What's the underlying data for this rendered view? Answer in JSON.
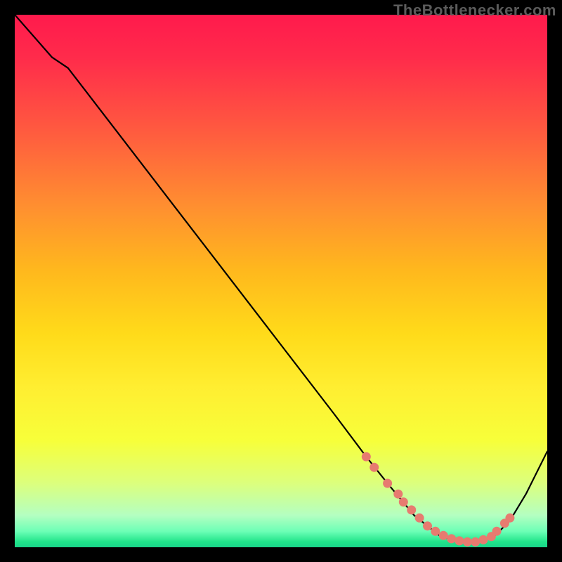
{
  "watermark": "TheBottlenecker.com",
  "chart_data": {
    "type": "line",
    "title": "",
    "xlabel": "",
    "ylabel": "",
    "xlim": [
      0,
      100
    ],
    "ylim": [
      0,
      100
    ],
    "series": [
      {
        "name": "curve",
        "x": [
          0,
          7,
          10,
          20,
          30,
          40,
          50,
          60,
          66,
          70,
          75,
          80,
          84,
          87,
          90,
          93,
          96,
          100
        ],
        "y": [
          100,
          92,
          90,
          77,
          64,
          51,
          38,
          25,
          17,
          12,
          6,
          2,
          1,
          1,
          2,
          5,
          10,
          18
        ]
      }
    ],
    "markers": {
      "name": "highlight-dots",
      "color": "#e77b70",
      "x": [
        66,
        67.5,
        70,
        72,
        73,
        74.5,
        76,
        77.5,
        79,
        80.5,
        82,
        83.5,
        85,
        86.5,
        88,
        89.5,
        90.5,
        92,
        93
      ],
      "y": [
        17,
        15,
        12,
        10,
        8.5,
        7,
        5.5,
        4,
        3,
        2.2,
        1.6,
        1.2,
        1,
        1,
        1.4,
        2,
        3,
        4.5,
        5.5
      ]
    }
  }
}
